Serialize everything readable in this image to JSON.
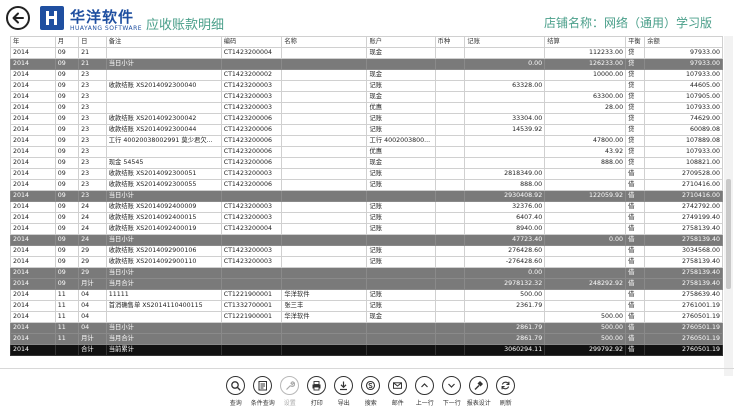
{
  "header": {
    "brand_cn": "华洋软件",
    "brand_en": "HUAYANG SOFTWARE",
    "title": "应收账款明细",
    "store_name": "店铺名称：网络（通用）学习版"
  },
  "table": {
    "columns": [
      "年",
      "月",
      "日",
      "备注",
      "编码",
      "名称",
      "账户",
      "币种",
      "记账",
      "结算",
      "平衡",
      "余额"
    ],
    "rows": [
      {
        "kind": "row",
        "cells": [
          "2014",
          "09",
          "21",
          "",
          "CT1423200004",
          "",
          "现金",
          "",
          "",
          "112233.00",
          "贷",
          "97933.00"
        ]
      },
      {
        "kind": "sub",
        "cells": [
          "2014",
          "09",
          "21",
          "当日小计",
          "",
          "",
          "",
          "",
          "0.00",
          "126233.00",
          "贷",
          "97933.00"
        ]
      },
      {
        "kind": "row",
        "cells": [
          "2014",
          "09",
          "23",
          "",
          "CT1423200002",
          "",
          "现金",
          "",
          "",
          "10000.00",
          "贷",
          "107933.00"
        ]
      },
      {
        "kind": "row",
        "cells": [
          "2014",
          "09",
          "23",
          "收款结账 XS2014092300040",
          "CT1423200003",
          "",
          "记账",
          "",
          "63328.00",
          "",
          "贷",
          "44605.00"
        ]
      },
      {
        "kind": "row",
        "cells": [
          "2014",
          "09",
          "23",
          "",
          "CT1423200003",
          "",
          "现金",
          "",
          "",
          "63300.00",
          "贷",
          "107905.00"
        ]
      },
      {
        "kind": "row",
        "cells": [
          "2014",
          "09",
          "23",
          "",
          "CT1423200003",
          "",
          "优惠",
          "",
          "",
          "28.00",
          "贷",
          "107933.00"
        ]
      },
      {
        "kind": "row",
        "cells": [
          "2014",
          "09",
          "23",
          "收款结账 XS2014092300042",
          "CT1423200006",
          "",
          "记账",
          "",
          "33304.00",
          "",
          "贷",
          "74629.00"
        ]
      },
      {
        "kind": "row",
        "cells": [
          "2014",
          "09",
          "23",
          "收款结账 XS2014092300044",
          "CT1423200006",
          "",
          "记账",
          "",
          "14539.92",
          "",
          "贷",
          "60089.08"
        ]
      },
      {
        "kind": "row",
        "cells": [
          "2014",
          "09",
          "23",
          "工行 40020038002991 莫少君欠...",
          "CT1423200006",
          "",
          "工行 4002003800...",
          "",
          "",
          "47800.00",
          "贷",
          "107889.08"
        ]
      },
      {
        "kind": "row",
        "cells": [
          "2014",
          "09",
          "23",
          "",
          "CT1423200006",
          "",
          "优惠",
          "",
          "",
          "43.92",
          "贷",
          "107933.00"
        ]
      },
      {
        "kind": "row",
        "cells": [
          "2014",
          "09",
          "23",
          "现金 54545",
          "CT1423200006",
          "",
          "现金",
          "",
          "",
          "888.00",
          "贷",
          "108821.00"
        ]
      },
      {
        "kind": "row",
        "cells": [
          "2014",
          "09",
          "23",
          "收款结账 XS2014092300051",
          "CT1423200003",
          "",
          "记账",
          "",
          "2818349.00",
          "",
          "借",
          "2709528.00"
        ]
      },
      {
        "kind": "row",
        "cells": [
          "2014",
          "09",
          "23",
          "收款结账 XS2014092300055",
          "CT1423200006",
          "",
          "记账",
          "",
          "888.00",
          "",
          "借",
          "2710416.00"
        ]
      },
      {
        "kind": "sub",
        "cells": [
          "2014",
          "09",
          "23",
          "当日小计",
          "",
          "",
          "",
          "",
          "2930408.92",
          "122059.92",
          "借",
          "2710416.00"
        ]
      },
      {
        "kind": "row",
        "cells": [
          "2014",
          "09",
          "24",
          "收款结账 XS2014092400009",
          "CT1423200003",
          "",
          "记账",
          "",
          "32376.00",
          "",
          "借",
          "2742792.00"
        ]
      },
      {
        "kind": "row",
        "cells": [
          "2014",
          "09",
          "24",
          "收款结账 XS2014092400015",
          "CT1423200003",
          "",
          "记账",
          "",
          "6407.40",
          "",
          "借",
          "2749199.40"
        ]
      },
      {
        "kind": "row",
        "cells": [
          "2014",
          "09",
          "24",
          "收款结账 XS2014092400019",
          "CT1423200004",
          "",
          "记账",
          "",
          "8940.00",
          "",
          "借",
          "2758139.40"
        ]
      },
      {
        "kind": "sub",
        "cells": [
          "2014",
          "09",
          "24",
          "当日小计",
          "",
          "",
          "",
          "",
          "47723.40",
          "0.00",
          "借",
          "2758139.40"
        ]
      },
      {
        "kind": "row",
        "cells": [
          "2014",
          "09",
          "29",
          "收款结账 XS2014092900106",
          "CT1423200003",
          "",
          "记账",
          "",
          "276428.60",
          "",
          "借",
          "3034568.00"
        ]
      },
      {
        "kind": "row",
        "cells": [
          "2014",
          "09",
          "29",
          "收款结账 XS2014092900110",
          "CT1423200003",
          "",
          "记账",
          "",
          "-276428.60",
          "",
          "借",
          "2758139.40"
        ]
      },
      {
        "kind": "sub",
        "cells": [
          "2014",
          "09",
          "29",
          "当日小计",
          "",
          "",
          "",
          "",
          "0.00",
          "",
          "借",
          "2758139.40"
        ]
      },
      {
        "kind": "sub",
        "cells": [
          "2014",
          "09",
          "月计",
          "当月合计",
          "",
          "",
          "",
          "",
          "2978132.32",
          "248292.92",
          "借",
          "2758139.40"
        ]
      },
      {
        "kind": "row",
        "cells": [
          "2014",
          "11",
          "04",
          "11111",
          "CT1221900001",
          "华洋软件",
          "记账",
          "",
          "500.00",
          "",
          "借",
          "2758639.40"
        ]
      },
      {
        "kind": "row",
        "cells": [
          "2014",
          "11",
          "04",
          "首消确售单 XS2014110400115",
          "CT1332700001",
          "张三丰",
          "记账",
          "",
          "2361.79",
          "",
          "借",
          "2761001.19"
        ]
      },
      {
        "kind": "row",
        "cells": [
          "2014",
          "11",
          "04",
          "",
          "CT1221900001",
          "华洋软件",
          "现金",
          "",
          "",
          "500.00",
          "借",
          "2760501.19"
        ]
      },
      {
        "kind": "sub",
        "cells": [
          "2014",
          "11",
          "04",
          "当日小计",
          "",
          "",
          "",
          "",
          "2861.79",
          "500.00",
          "借",
          "2760501.19"
        ]
      },
      {
        "kind": "sub",
        "cells": [
          "2014",
          "11",
          "月计",
          "当月合计",
          "",
          "",
          "",
          "",
          "2861.79",
          "500.00",
          "借",
          "2760501.19"
        ]
      },
      {
        "kind": "total",
        "cells": [
          "2014",
          "",
          "合计",
          "当前累计",
          "",
          "",
          "",
          "",
          "3060294.11",
          "299792.92",
          "借",
          "2760501.19"
        ]
      }
    ]
  },
  "toolbar": [
    {
      "label": "查询",
      "icon": "search-icon",
      "enabled": true
    },
    {
      "label": "条件查询",
      "icon": "filter-list-icon",
      "enabled": true
    },
    {
      "label": "设置",
      "icon": "wrench-icon",
      "enabled": false
    },
    {
      "label": "打印",
      "icon": "printer-icon",
      "enabled": true
    },
    {
      "label": "导出",
      "icon": "download-icon",
      "enabled": true
    },
    {
      "label": "搜索",
      "icon": "skype-icon",
      "enabled": true
    },
    {
      "label": "邮件",
      "icon": "mail-icon",
      "enabled": true
    },
    {
      "label": "上一行",
      "icon": "chevron-up-icon",
      "enabled": true
    },
    {
      "label": "下一行",
      "icon": "chevron-down-icon",
      "enabled": true
    },
    {
      "label": "报表设计",
      "icon": "hammer-icon",
      "enabled": true
    },
    {
      "label": "刷新",
      "icon": "refresh-icon",
      "enabled": true
    }
  ]
}
